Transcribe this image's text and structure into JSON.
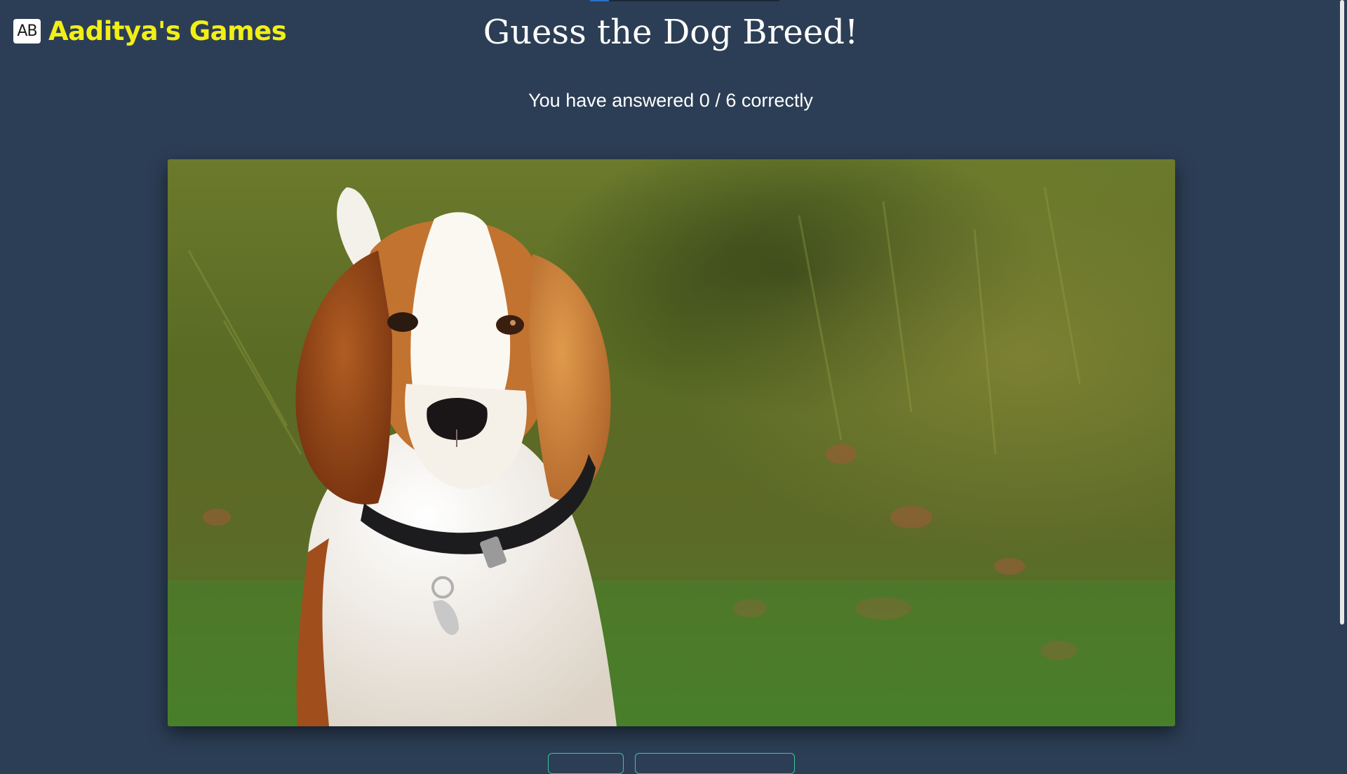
{
  "brand": {
    "logo_text": "AB",
    "name": "Aaditya's Games"
  },
  "page": {
    "title": "Guess the Dog Breed!",
    "score_text": "You have answered 0 / 6 correctly"
  },
  "photo": {
    "subject": "beagle dog sitting on grass with black collar"
  },
  "answers": {
    "option_1": "",
    "option_2": ""
  },
  "colors": {
    "background": "#2c3e55",
    "brand_text": "#f2ef16",
    "button_border": "#3cc79a",
    "title_text": "#ffffff"
  }
}
